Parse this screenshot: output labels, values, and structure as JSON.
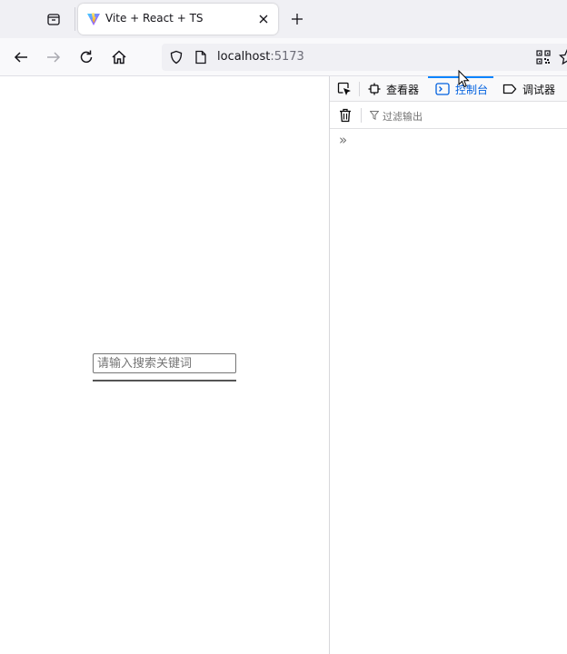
{
  "browser": {
    "tab": {
      "title": "Vite + React + TS"
    },
    "url": {
      "host": "localhost",
      "port": ":5173"
    }
  },
  "page": {
    "search_placeholder": "请输入搜索关键词"
  },
  "devtools": {
    "tabs": [
      {
        "label": "查看器",
        "icon": "inspector-icon",
        "active": false
      },
      {
        "label": "控制台",
        "icon": "console-icon",
        "active": true
      },
      {
        "label": "调试器",
        "icon": "debugger-icon",
        "active": false
      }
    ],
    "filter_placeholder": "过滤输出",
    "prompt": "»"
  },
  "colors": {
    "accent": "#0060df",
    "tab_bar": "#f0f0f4",
    "nav_bar": "#f9f9fb"
  }
}
